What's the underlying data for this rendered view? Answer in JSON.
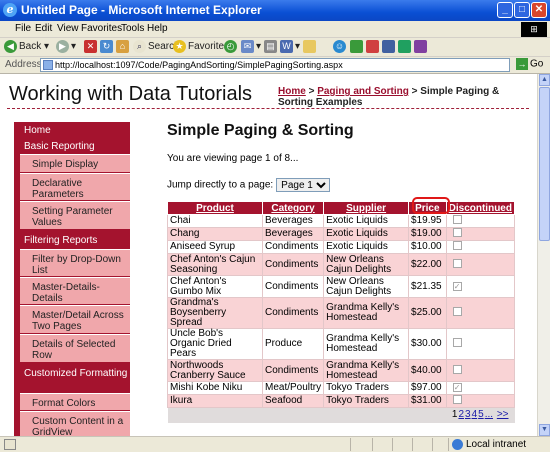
{
  "window": {
    "title": "Untitled Page - Microsoft Internet Explorer",
    "buttons": [
      "_",
      "□",
      "✕"
    ]
  },
  "menu": [
    "File",
    "Edit",
    "View",
    "Favorites",
    "Tools",
    "Help"
  ],
  "toolbar": {
    "back": "Back",
    "search": "Search",
    "favorites": "Favorites"
  },
  "address": {
    "label": "Address",
    "url": "http://localhost:1097/Code/PagingAndSorting/SimplePagingSorting.aspx",
    "go": "Go"
  },
  "status": {
    "zone": "Local intranet"
  },
  "site": {
    "title": "Working with Data Tutorials",
    "breadcrumb": {
      "home": "Home",
      "sep1": " > ",
      "section": "Paging and Sorting",
      "sep2": " > ",
      "current": "Simple Paging & Sorting Examples"
    }
  },
  "sidebar": {
    "items": [
      {
        "label": "Home",
        "type": "top"
      },
      {
        "label": "Basic Reporting",
        "type": "top"
      },
      {
        "label": "Simple Display",
        "type": "sub"
      },
      {
        "label": "Declarative Parameters",
        "type": "sub"
      },
      {
        "label": "Setting Parameter Values",
        "type": "sub"
      },
      {
        "label": "Filtering Reports",
        "type": "top"
      },
      {
        "label": "Filter by Drop-Down List",
        "type": "sub"
      },
      {
        "label": "Master-Details-Details",
        "type": "sub"
      },
      {
        "label": "Master/Detail Across Two Pages",
        "type": "sub"
      },
      {
        "label": "Details of Selected Row",
        "type": "sub"
      },
      {
        "label": "Customized Formatting",
        "type": "top"
      },
      {
        "label": "Format Colors",
        "type": "sub"
      },
      {
        "label": "Custom Content in a GridView",
        "type": "sub"
      }
    ]
  },
  "main": {
    "heading": "Simple Paging & Sorting",
    "viewing": "You are viewing page 1 of 8...",
    "jump_label": "Jump directly to a page:",
    "jump_value": "Page 1"
  },
  "grid": {
    "headers": [
      "Product",
      "Category",
      "Supplier",
      "Price",
      "Discontinued"
    ],
    "rows": [
      {
        "product": "Chai",
        "category": "Beverages",
        "supplier": "Exotic Liquids",
        "price": "$19.95",
        "discontinued": false
      },
      {
        "product": "Chang",
        "category": "Beverages",
        "supplier": "Exotic Liquids",
        "price": "$19.00",
        "discontinued": false
      },
      {
        "product": "Aniseed Syrup",
        "category": "Condiments",
        "supplier": "Exotic Liquids",
        "price": "$10.00",
        "discontinued": false
      },
      {
        "product": "Chef Anton's Cajun Seasoning",
        "category": "Condiments",
        "supplier": "New Orleans Cajun Delights",
        "price": "$22.00",
        "discontinued": false
      },
      {
        "product": "Chef Anton's Gumbo Mix",
        "category": "Condiments",
        "supplier": "New Orleans Cajun Delights",
        "price": "$21.35",
        "discontinued": true
      },
      {
        "product": "Grandma's Boysenberry Spread",
        "category": "Condiments",
        "supplier": "Grandma Kelly's Homestead",
        "price": "$25.00",
        "discontinued": false
      },
      {
        "product": "Uncle Bob's Organic Dried Pears",
        "category": "Produce",
        "supplier": "Grandma Kelly's Homestead",
        "price": "$30.00",
        "discontinued": false
      },
      {
        "product": "Northwoods Cranberry Sauce",
        "category": "Condiments",
        "supplier": "Grandma Kelly's Homestead",
        "price": "$40.00",
        "discontinued": false
      },
      {
        "product": "Mishi Kobe Niku",
        "category": "Meat/Poultry",
        "supplier": "Tokyo Traders",
        "price": "$97.00",
        "discontinued": true
      },
      {
        "product": "Ikura",
        "category": "Seafood",
        "supplier": "Tokyo Traders",
        "price": "$31.00",
        "discontinued": false
      }
    ],
    "pager": {
      "current": "1",
      "pages": [
        "2",
        "3",
        "4",
        "5"
      ],
      "ellipsis": "...",
      "last": ">>"
    }
  }
}
